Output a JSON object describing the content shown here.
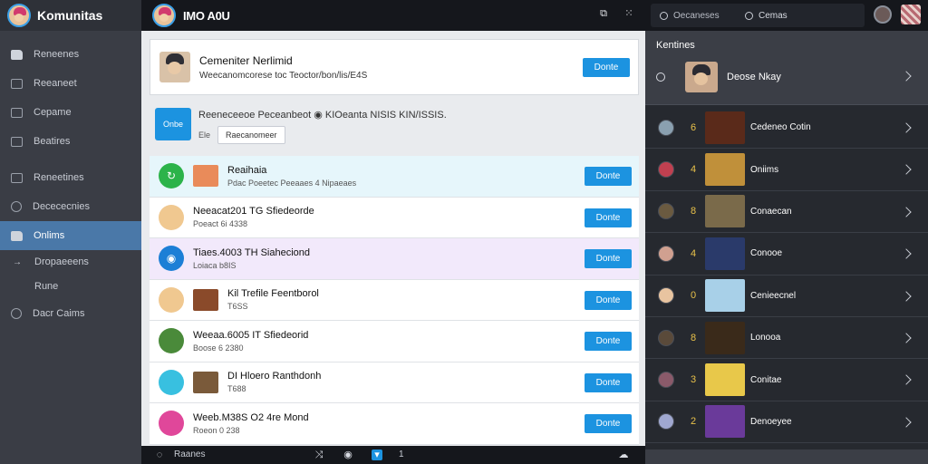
{
  "app": {
    "title": "Komunitas"
  },
  "sidebar": {
    "items": [
      {
        "label": "Reneenes",
        "icon": "folder-icon"
      },
      {
        "label": "Reeaneet",
        "icon": "file-icon"
      },
      {
        "label": "Cepame",
        "icon": "tag-icon"
      },
      {
        "label": "Beatires",
        "icon": "list-icon"
      },
      {
        "label": "Reneetines",
        "icon": "people-icon"
      },
      {
        "label": "Decececnies",
        "icon": "clock-icon"
      },
      {
        "label": "Onlims",
        "icon": "cloud-icon",
        "active": true
      },
      {
        "label": "Dropaeeens",
        "icon": "arrow-icon"
      },
      {
        "label": "Rune",
        "icon": ""
      },
      {
        "label": "Dacr Caims",
        "icon": "gear-icon"
      }
    ]
  },
  "topbar": {
    "user_name": "IMO A0U",
    "search_placeholder_a": "Oecaneses",
    "search_placeholder_b": "Cemas"
  },
  "main": {
    "header_card": {
      "title": "Cemeniter Nerlimid",
      "subtitle": "Weecanomcorese toc Teoctor/bon/lis/E4S",
      "button": "Donte"
    },
    "promo": {
      "logo_text": "Onbe",
      "text": "Reeneceeoe Peceanbeot ◉ KIOeanta NISIS KIN/ISSIS.",
      "tag": "Ele",
      "select_value": "Raecanomeer"
    },
    "rows": [
      {
        "title": "Reaihaia",
        "subtitle": "Pdac Poeetec Peeaaes 4 Nipaeaes",
        "button": "Donte",
        "style": "hl1",
        "avatar_color": "#2cb34a",
        "avatar_glyph": "↻",
        "thumb_color": "#e98b5a"
      },
      {
        "title": "Neeacat201 TG Sfiedeorde",
        "subtitle": "Poeact 6i 4338",
        "button": "Donte",
        "style": "",
        "avatar_color": "#f0c890",
        "avatar_glyph": "",
        "thumb_color": ""
      },
      {
        "title": "Tiaes.4003 TH Siaheciond",
        "subtitle": "Loiaca b8IS",
        "button": "Donte",
        "style": "hl2",
        "avatar_color": "#1c7fd6",
        "avatar_glyph": "◉",
        "thumb_color": ""
      },
      {
        "title": "Kil Trefile Feentborol",
        "subtitle": "T6SS",
        "button": "Donte",
        "style": "",
        "avatar_color": "#f0c890",
        "avatar_glyph": "",
        "thumb_color": "#8a4a2a"
      },
      {
        "title": "Weeaa.6005 IT Sfiedeorid",
        "subtitle": "Boose 6 2380",
        "button": "Donte",
        "style": "",
        "avatar_color": "#4a8a3a",
        "avatar_glyph": "",
        "thumb_color": ""
      },
      {
        "title": "DI Hloero Ranthdonh",
        "subtitle": "T688",
        "button": "Donte",
        "style": "",
        "avatar_color": "#38c0e0",
        "avatar_glyph": "",
        "thumb_color": "#7a5a3a"
      },
      {
        "title": "Weeb.M38S O2 4re Mond",
        "subtitle": "Roeon 0 238",
        "button": "Donte",
        "style": "",
        "avatar_color": "#e0479a",
        "avatar_glyph": "",
        "thumb_color": ""
      }
    ]
  },
  "bottom": {
    "label": "Raanes",
    "count": "1"
  },
  "right": {
    "title": "Kentines",
    "feature": {
      "name": "Deose Nkay"
    },
    "items": [
      {
        "num": "6",
        "label": "Cedeneo Cotin",
        "avatar_color": "#8aa0b0",
        "thumb_color": "#5a2a1a"
      },
      {
        "num": "4",
        "label": "Oniims",
        "avatar_color": "#c04050",
        "thumb_color": "#c0903a"
      },
      {
        "num": "8",
        "label": "Conaecan",
        "avatar_color": "#6a5a40",
        "thumb_color": "#7a6a4a"
      },
      {
        "num": "4",
        "label": "Conooe",
        "avatar_color": "#d0a090",
        "thumb_color": "#2a3a6a"
      },
      {
        "num": "0",
        "label": "Cenieecnel",
        "avatar_color": "#e8c4a0",
        "thumb_color": "#a8d0e8"
      },
      {
        "num": "8",
        "label": "Lonooa",
        "avatar_color": "#5a4a3a",
        "thumb_color": "#3a2a1a"
      },
      {
        "num": "3",
        "label": "Conitae",
        "avatar_color": "#8a5a6a",
        "thumb_color": "#e8c84a"
      },
      {
        "num": "2",
        "label": "Denoeyee",
        "avatar_color": "#a0a8d0",
        "thumb_color": "#6a3a9a"
      }
    ]
  },
  "colors": {
    "accent": "#1c93e0",
    "sidebar_active": "#4a78a8",
    "rank_number": "#e8c14a"
  }
}
